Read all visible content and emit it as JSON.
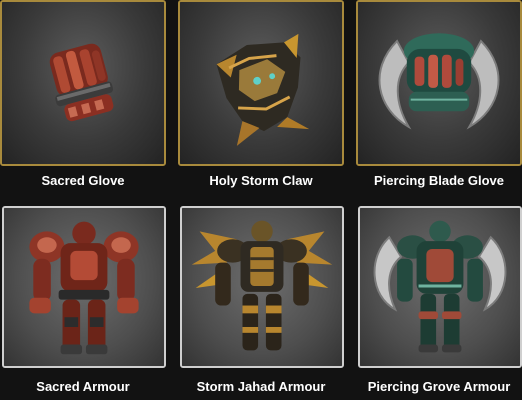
{
  "items": [
    {
      "name": "Sacred Glove",
      "icon": "sacred-glove-icon"
    },
    {
      "name": "Holy Storm Claw",
      "icon": "holy-storm-claw-icon"
    },
    {
      "name": "Piercing Blade Glove",
      "icon": "piercing-blade-glove-icon"
    },
    {
      "name": "Sacred Armour",
      "icon": "sacred-armour-icon"
    },
    {
      "name": "Storm Jahad Armour",
      "icon": "storm-jahad-armour-icon"
    },
    {
      "name": "Piercing Grove Armour",
      "icon": "piercing-grove-armour-icon"
    }
  ],
  "colors": {
    "top_frame_border": "#a88a3c",
    "bottom_frame_border": "#cfcfcf",
    "label_text": "#ffffff",
    "background": "#121212"
  }
}
